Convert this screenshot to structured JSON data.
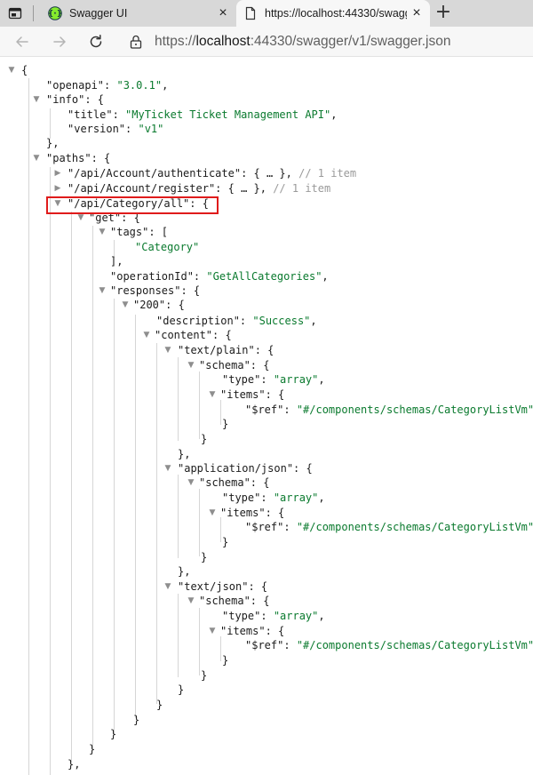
{
  "browser": {
    "tabs": [
      {
        "title": "Swagger UI",
        "close": "×"
      },
      {
        "title": "https://localhost:44330/swagger/v1/swagger.json",
        "close": "×"
      }
    ],
    "new_tab": "+",
    "url_scheme": "https://",
    "url_host": "localhost",
    "url_rest": ":44330/swagger/v1/swagger.json"
  },
  "json": {
    "l1": {
      "brace": "{"
    },
    "l2": {
      "key": "\"openapi\"",
      "sep": ": ",
      "val": "\"3.0.1\"",
      "end": ","
    },
    "l3": {
      "key": "\"info\"",
      "sep": ": {"
    },
    "l4": {
      "key": "\"title\"",
      "sep": ": ",
      "val": "\"MyTicket Ticket Management API\"",
      "end": ","
    },
    "l5": {
      "key": "\"version\"",
      "sep": ": ",
      "val": "\"v1\""
    },
    "l6": {
      "text": "},"
    },
    "l7": {
      "key": "\"paths\"",
      "sep": ": {"
    },
    "l8": {
      "key": "\"/api/Account/authenticate\"",
      "sep": ": { … }, ",
      "comment": "// 1 item"
    },
    "l9": {
      "key": "\"/api/Account/register\"",
      "sep": ": { … }, ",
      "comment": "// 1 item"
    },
    "l10": {
      "key": "\"/api/Category/all\"",
      "sep": ": {"
    },
    "l11": {
      "key": "\"get\"",
      "sep": ": {"
    },
    "l12": {
      "key": "\"tags\"",
      "sep": ": ["
    },
    "l13": {
      "val": "\"Category\""
    },
    "l14": {
      "text": "],"
    },
    "l15": {
      "key": "\"operationId\"",
      "sep": ": ",
      "val": "\"GetAllCategories\"",
      "end": ","
    },
    "l16": {
      "key": "\"responses\"",
      "sep": ": {"
    },
    "l17": {
      "key": "\"200\"",
      "sep": ": {"
    },
    "l18": {
      "key": "\"description\"",
      "sep": ": ",
      "val": "\"Success\"",
      "end": ","
    },
    "l19": {
      "key": "\"content\"",
      "sep": ": {"
    },
    "l20": {
      "key": "\"text/plain\"",
      "sep": ": {"
    },
    "l21": {
      "key": "\"schema\"",
      "sep": ": {"
    },
    "l22": {
      "key": "\"type\"",
      "sep": ": ",
      "val": "\"array\"",
      "end": ","
    },
    "l23": {
      "key": "\"items\"",
      "sep": ": {"
    },
    "l24": {
      "key": "\"$ref\"",
      "sep": ": ",
      "val": "\"#/components/schemas/CategoryListVm\""
    },
    "l25": {
      "text": "}"
    },
    "l26": {
      "text": "}"
    },
    "l27": {
      "text": "},"
    },
    "l28": {
      "key": "\"application/json\"",
      "sep": ": {"
    },
    "l29": {
      "key": "\"schema\"",
      "sep": ": {"
    },
    "l30": {
      "key": "\"type\"",
      "sep": ": ",
      "val": "\"array\"",
      "end": ","
    },
    "l31": {
      "key": "\"items\"",
      "sep": ": {"
    },
    "l32": {
      "key": "\"$ref\"",
      "sep": ": ",
      "val": "\"#/components/schemas/CategoryListVm\""
    },
    "l33": {
      "text": "}"
    },
    "l34": {
      "text": "}"
    },
    "l35": {
      "text": "},"
    },
    "l36": {
      "key": "\"text/json\"",
      "sep": ": {"
    },
    "l37": {
      "key": "\"schema\"",
      "sep": ": {"
    },
    "l38": {
      "key": "\"type\"",
      "sep": ": ",
      "val": "\"array\"",
      "end": ","
    },
    "l39": {
      "key": "\"items\"",
      "sep": ": {"
    },
    "l40": {
      "key": "\"$ref\"",
      "sep": ": ",
      "val": "\"#/components/schemas/CategoryListVm\""
    },
    "l41": {
      "text": "}"
    },
    "l42": {
      "text": "}"
    },
    "l43": {
      "text": "}"
    },
    "l44": {
      "text": "}"
    },
    "l45": {
      "text": "}"
    },
    "l46": {
      "text": "}"
    },
    "l47": {
      "text": "}"
    },
    "l48": {
      "text": "},"
    }
  },
  "colors": {
    "string": "#0a7a2e",
    "comment": "#9a9a9a",
    "highlight": "#e01b1b"
  },
  "icons": {
    "expanded": "▼",
    "collapsed": "▶"
  }
}
